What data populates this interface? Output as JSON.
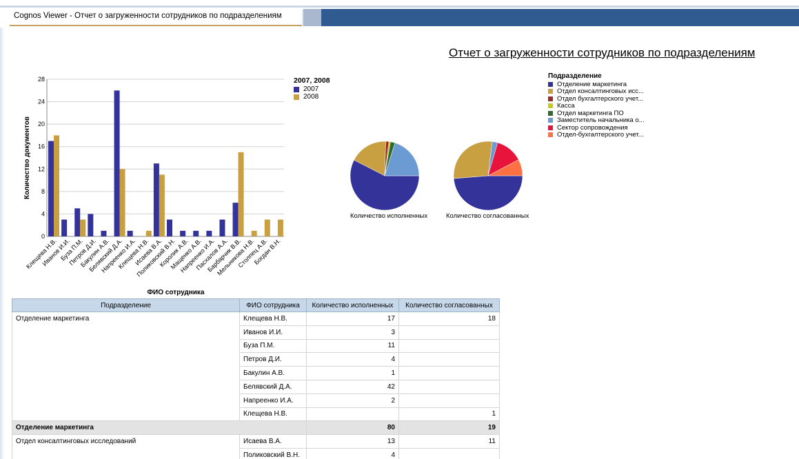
{
  "window": {
    "tab_title": "Cognos Viewer - Отчет о загруженности сотрудников по подразделениям"
  },
  "report": {
    "title": "Отчет о загруженности сотрудников по подразделениям"
  },
  "colors": {
    "series_2007": "#333399",
    "series_2008": "#c8a042",
    "header_bg": "#c6d8ea",
    "banner": "#2f5b91"
  },
  "chart_data": [
    {
      "type": "bar",
      "title": "",
      "xlabel": "ФИО сотрудника",
      "ylabel": "Количество документов",
      "ylim": [
        0,
        28
      ],
      "yticks": [
        0,
        4,
        8,
        12,
        16,
        20,
        24,
        28
      ],
      "grid": true,
      "legend_title": "2007, 2008",
      "legend_position": "right",
      "categories": [
        "Клещева Н.В.",
        "Иванов И.И.",
        "Буза П.М.",
        "Петров Д.И.",
        "Бакулин А.В.",
        "Белявский Д.А.",
        "Напреенко И.А.",
        "Клещева Н.В.",
        "Исаева В.А.",
        "Поликовский В.Н.",
        "Королик А.В.",
        "Мащенко А.В.",
        "Напреенко И.А.",
        "Пасхалов А.А.",
        "Барбарчик В.В.",
        "Мельникова Н.В.",
        "Столпец А.В.",
        "Богдан В.Н."
      ],
      "series": [
        {
          "name": "2007",
          "values": [
            17,
            3,
            5,
            4,
            1,
            26,
            1,
            0,
            13,
            3,
            1,
            1,
            1,
            3,
            6,
            0,
            0,
            0
          ]
        },
        {
          "name": "2008",
          "values": [
            18,
            0,
            3,
            0,
            0,
            12,
            0,
            1,
            11,
            0,
            0,
            0,
            0,
            0,
            15,
            1,
            3,
            3
          ]
        }
      ]
    },
    {
      "type": "pie",
      "legend_title": "Подразделение",
      "legend_position": "right",
      "categories": [
        "Отделение маркетинга",
        "Отдел консалтинговых исс...",
        "Отдел бухгалтерского учет...",
        "Касса",
        "Отдел маркетинга ПО",
        "Заместитель начальника о...",
        "Сектор сопровождения",
        "Отдел-бухгалтерского учет..."
      ],
      "category_colors": [
        "#333399",
        "#c8a042",
        "#9b2a2a",
        "#c8c820",
        "#2f6b2a",
        "#6b9bd2",
        "#e8143c",
        "#ff7043"
      ],
      "pies": [
        {
          "label": "Количество исполненных",
          "values": [
            80,
            25,
            2,
            1,
            3,
            28,
            0,
            0
          ]
        },
        {
          "label": "Количество согласованных",
          "values": [
            19,
            11,
            0,
            0,
            0,
            1,
            5,
            3
          ]
        }
      ]
    }
  ],
  "table": {
    "headers": [
      "Подразделение",
      "ФИО сотрудника",
      "Количество исполненных",
      "Количество согласованных"
    ],
    "rows": [
      {
        "dept": "Отделение маркетинга",
        "name": "Клещева Н.В.",
        "executed": "17",
        "approved": "18"
      },
      {
        "dept": "",
        "name": "Иванов И.И.",
        "executed": "3",
        "approved": ""
      },
      {
        "dept": "",
        "name": "Буза П.М.",
        "executed": "11",
        "approved": ""
      },
      {
        "dept": "",
        "name": "Петров Д.И.",
        "executed": "4",
        "approved": ""
      },
      {
        "dept": "",
        "name": "Бакулин А.В.",
        "executed": "1",
        "approved": ""
      },
      {
        "dept": "",
        "name": "Белявский Д.А.",
        "executed": "42",
        "approved": ""
      },
      {
        "dept": "",
        "name": "Напреенко И.А.",
        "executed": "2",
        "approved": ""
      },
      {
        "dept": "",
        "name": "Клещева Н.В.",
        "executed": "",
        "approved": "1"
      }
    ],
    "subtotal": {
      "dept": "Отделение маркетинга",
      "executed": "80",
      "approved": "19"
    },
    "rows2": [
      {
        "dept": "Отдел консалтинговых исследований",
        "name": "Исаева В.А.",
        "executed": "13",
        "approved": "11"
      },
      {
        "dept": "",
        "name": "Поликовский В.Н.",
        "executed": "4",
        "approved": ""
      }
    ]
  }
}
